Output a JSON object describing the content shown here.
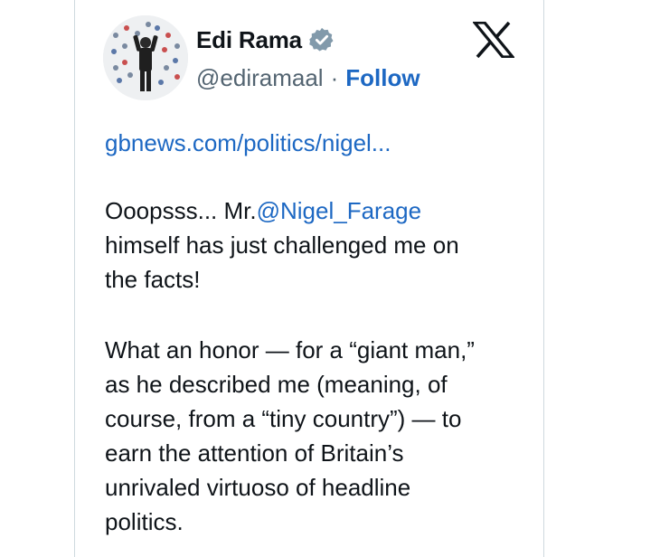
{
  "author": {
    "display_name": "Edi Rama",
    "handle": "@ediramaal",
    "separator": "·",
    "follow_label": "Follow",
    "verified_icon": "verified-badge-icon"
  },
  "platform": {
    "logo_icon": "x-logo-icon"
  },
  "tweet": {
    "link": "gbnews.com/politics/nigel...",
    "para1": {
      "prefix": "Ooopsss... Mr.",
      "mention": "@Nigel_Farage",
      "line2": "himself has just challenged me on",
      "line3": "the facts!"
    },
    "para2": {
      "line1": "What an honor — for a “giant man,”",
      "line2": "as he described me (meaning, of",
      "line3": "course, from a “tiny country”) — to",
      "line4": "earn the attention of Britain’s",
      "line5": "unrivaled virtuoso of headline",
      "line6": "politics."
    }
  },
  "colors": {
    "link_blue": "#1d68c3",
    "text": "#0f1419",
    "secondary": "#536471",
    "border": "#cfd9de",
    "verified": "#829aab"
  }
}
